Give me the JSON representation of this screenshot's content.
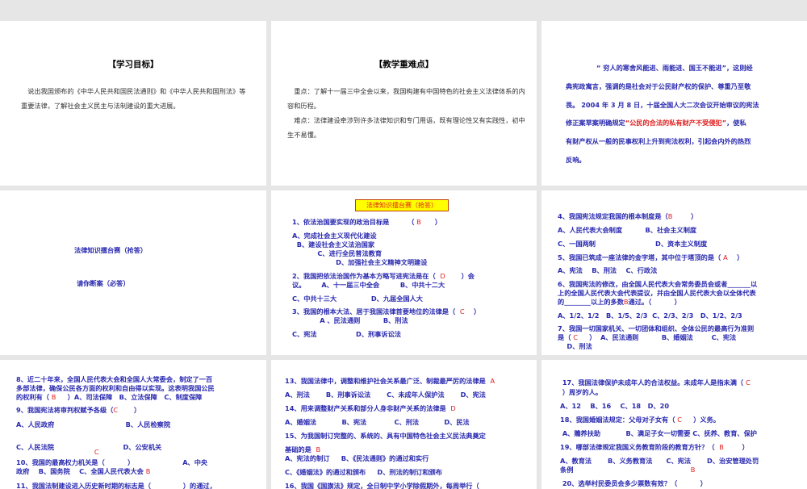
{
  "slides": [
    {
      "title": "【学习目标】",
      "text": "说出我国颁布的《中华人民共和国民法通则》和《中华人民共和国刑法》等重要法律，了解社会主义民主与法制建设的重大进展。"
    },
    {
      "title": "【教学重难点】",
      "p1": "重点：了解十一届三中全会以来，我国构建有中国特色的社会主义法律体系的内容和历程。",
      "p2": "难点：法律建设牵涉到许多法律知识和专门用语，既有理论性又有实践性，初中生不易懂。"
    },
    {
      "l1": "“ 穷人的寒舍风能进、雨能进、国王不能进”，这则经",
      "l2": "典宪政寓言，强调的是社会对于公民财产权的保护、尊重乃至敬",
      "l3": "畏。 2004 年 3 月 8 日，十届全国人大二次会议开始审议的宪法",
      "l4a": "修正案草案明确规定",
      "l4b": "“公民的合法的私有财产不受侵犯”",
      "l4c": "，使私",
      "l5": "有财产权从一般的民事权利上升到宪法权利，引起会内外的热烈",
      "l6": "反响。"
    },
    {
      "link1": "法律知识擂台赛（抢答）",
      "link2": "请你断案（必答）"
    },
    {
      "banner": "法律知识擂台赛（抢答）",
      "lines": [
        [
          "1、依法治国要实现的政治目标是        （ ",
          "B",
          "      ）"
        ],
        [
          "A、完成社会主义现代化建设",
          "",
          ""
        ],
        [
          "  B、建设社会主义法治国家",
          "",
          ""
        ],
        [
          "           C、进行全民普法教育",
          "",
          ""
        ],
        [
          "                   D、加强社会主义精神文明建设",
          "",
          ""
        ],
        [
          "2、我国把依法治国作为基本方略写进宪法是在（  ",
          "D",
          "       ）会"
        ],
        [
          "议。       A、十一届三中全会         B、中共十二大",
          "",
          ""
        ],
        [
          "C、中共十三大               D、九届全国人大",
          "",
          ""
        ],
        [
          "3、我国的根本大法、居于我国法律首要地位的法律是（  ",
          "C",
          "    ）"
        ],
        [
          "            A 、民法通则          B、刑法",
          "",
          ""
        ],
        [
          "C、宪法                 D、刑事诉讼法",
          "",
          ""
        ]
      ]
    },
    {
      "lines": [
        [
          "4、我国宪法规定我国的根本制度是（",
          "B",
          "        ）"
        ],
        [
          "A、人民代表大会制度          B、社会主义制度",
          "",
          ""
        ],
        [
          "C、一国两制                          D、资本主义制度",
          "",
          ""
        ],
        [
          "5、我国已筑成一座法律的金字塔，其中位于塔顶的是（ ",
          "A",
          "    ）"
        ],
        [
          "A、宪法    B、刑法    C、行政法",
          "",
          ""
        ],
        [
          "6、我国宪法的修改，由全国人民代表大会常务委员会或者_______以",
          "",
          ""
        ],
        [
          "上的全国人民代表大会代表提议，并由全国人民代表大会以全体代表",
          "",
          ""
        ],
        [
          "的________以上的多数",
          "B",
          "通过。（          ）"
        ],
        [
          "A、1/2、1/2   B、1/5、2/3  C、2/3、2/3   D、1/2、2/3",
          "",
          ""
        ],
        [
          "7、我国一切国家机关、一切团体和组织、全体公民的最高行为准则",
          "",
          ""
        ],
        [
          "是（ ",
          "C",
          "     ）  A、民法通则          B、婚姻法        C、宪法"
        ],
        [
          "    D、刑法",
          "",
          ""
        ]
      ]
    },
    {
      "lines": [
        [
          "8、近二十年来，全国人民代表大会和全国人大常委会，制定了一百",
          "",
          ""
        ],
        [
          "多部法律，确保公民各方面的权利和自由得以实现。这表明我国公民",
          "",
          ""
        ],
        [
          "的权利有（ ",
          "B",
          "     ）A、司法保障   B、立法保障   C、制度保障"
        ],
        [
          "9、我国宪法将审判权赋予各级（",
          "C",
          "       ）"
        ],
        [
          "A、人民政府                               B、人民检察院",
          "",
          ""
        ],
        [
          "C、人民法院                              D、公安机关",
          "",
          ""
        ],
        [
          "                                  ",
          "C",
          ""
        ],
        [
          "10、我国的最高权力机关是（          ）                     A、中央",
          "",
          ""
        ],
        [
          "政府    B、国务院    C、全国人民代表大会 ",
          "B",
          ""
        ],
        [
          "11、我国法制建设进入历史新时期的标志是（              ）的通过，",
          "",
          ""
        ]
      ]
    },
    {
      "lines": [
        [
          "13、我国法律中，调整和维护社会关系最广泛、制裁最严厉的法律是  ",
          "A",
          ""
        ],
        [
          "A、刑法       B、刑事诉讼法       C、未成年人保护法       D、宪法",
          "",
          ""
        ],
        [
          "14、用来调整财产关系和部分人身非财产关系的法律是  ",
          "D",
          ""
        ],
        [
          "A、婚姻法           B、宪法            C、刑法           D、民法",
          "",
          ""
        ],
        [
          "15、为我国制订完整的、系统的、具有中国特色社会主义民法典奠定",
          "",
          ""
        ],
        [
          "基础的是  ",
          "B",
          ""
        ],
        [
          "A、宪法的制订     B、《民法通则》的通过和实行",
          "",
          ""
        ],
        [
          "C、《婚姻法》的通过和颁布     D、刑法的制订和颁布",
          "",
          ""
        ],
        [
          "16、我国《国旗法》规定，全日制中学小学除假期外，每周举行（",
          "",
          ""
        ]
      ]
    },
    {
      "lines": [
        [
          " 17、我国法律保护未成年人的合法权益。未成年人是指未满（ ",
          "C",
          ""
        ],
        [
          " ）周岁的人。",
          "",
          ""
        ],
        [
          "A、12    B、16    C、18   D、20",
          "",
          ""
        ],
        [
          "18、我国婚姻法规定：父母对子女有（ ",
          "C",
          "     ）义务。"
        ],
        [
          " A、赡养扶助           B、满足子女一切需要 C、抚养、教育、保护",
          "",
          ""
        ],
        [
          "19、哪部法律规定我国义务教育阶段的教育方针？（  ",
          "B",
          "        ）"
        ],
        [
          "A、教育法       B、义务教育法      C、宪法       D、治安管理处罚",
          "",
          ""
        ],
        [
          "条例                                                   ",
          "B",
          ""
        ],
        [
          " 20、选举村民委员会多少票数有效？（          ）",
          "",
          ""
        ]
      ]
    }
  ]
}
